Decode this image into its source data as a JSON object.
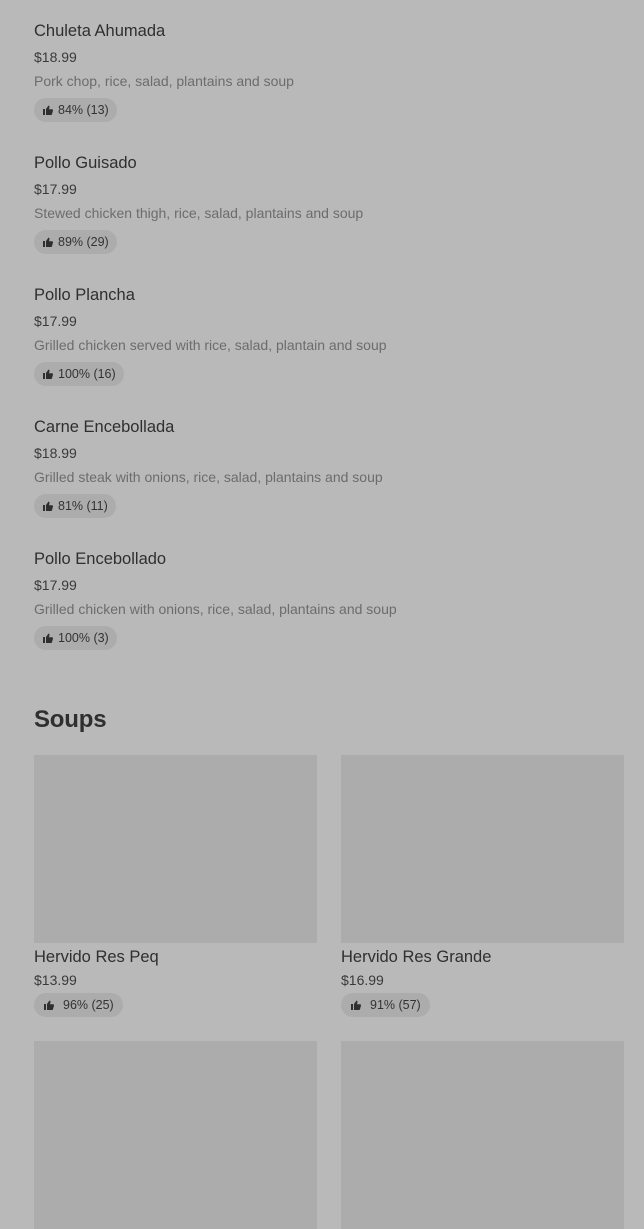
{
  "menu_items": [
    {
      "name": "Chuleta Ahumada",
      "price": "$18.99",
      "description": "Pork chop, rice, salad, plantains and soup",
      "rating": "84% (13)"
    },
    {
      "name": "Pollo Guisado",
      "price": "$17.99",
      "description": "Stewed chicken thigh, rice, salad, plantains and soup",
      "rating": "89% (29)"
    },
    {
      "name": "Pollo Plancha",
      "price": "$17.99",
      "description": "Grilled chicken served with rice, salad, plantain and soup",
      "rating": "100% (16)"
    },
    {
      "name": "Carne Encebollada",
      "price": "$18.99",
      "description": "Grilled steak with onions, rice, salad, plantains and soup",
      "rating": "81% (11)"
    },
    {
      "name": "Pollo Encebollado",
      "price": "$17.99",
      "description": "Grilled chicken with onions, rice, salad, plantains and soup",
      "rating": "100% (3)"
    }
  ],
  "soups": {
    "title": "Soups",
    "items": [
      {
        "name": "Hervido Res Peq",
        "price": "$13.99",
        "rating": "96% (25)"
      },
      {
        "name": "Hervido Res Grande",
        "price": "$16.99",
        "rating": "91% (57)"
      }
    ]
  },
  "icons": {
    "rating": "thumbs-up-icon"
  },
  "colors": {
    "background": "#b9b9b9",
    "placeholder": "#acacac",
    "pill": "#acacac"
  }
}
